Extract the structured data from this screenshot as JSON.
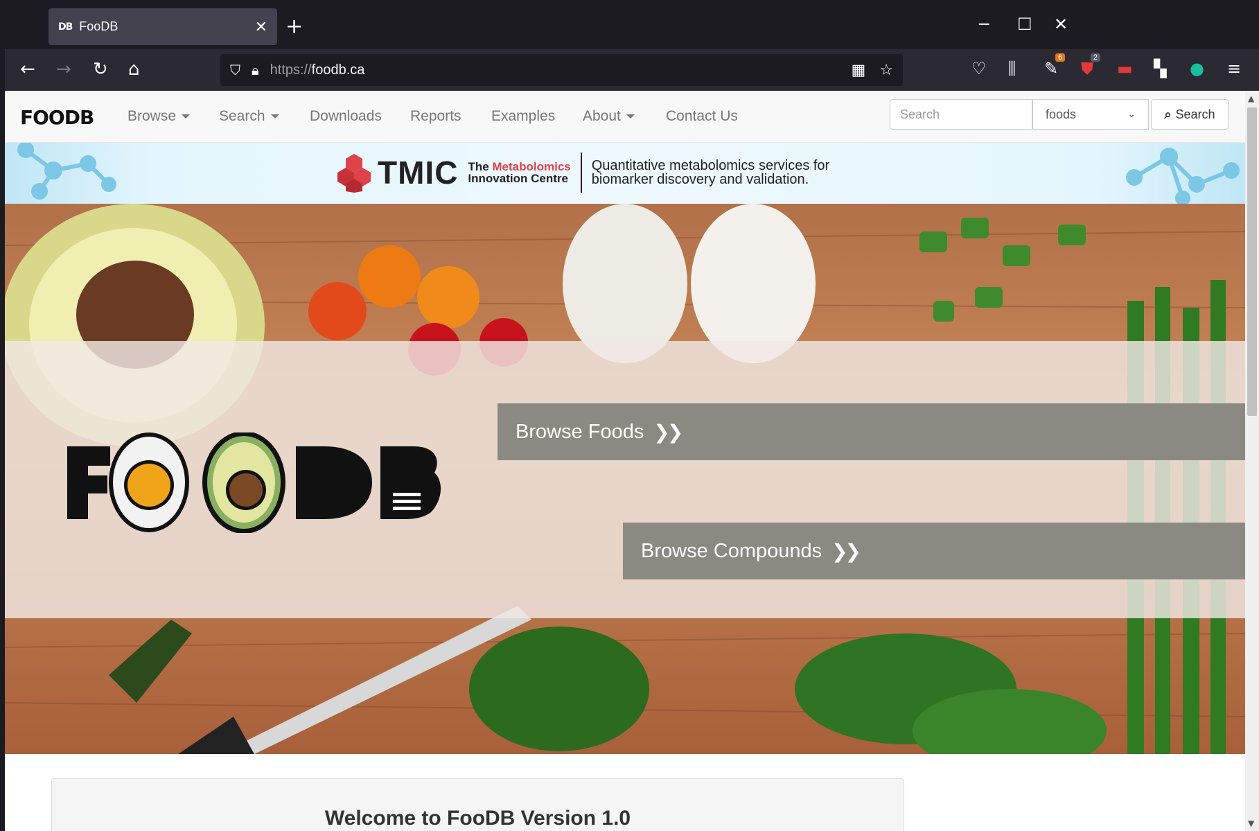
{
  "browser": {
    "tab_favicon": "DB",
    "tab_title": "FooDB",
    "tab_close": "✕",
    "new_tab": "+",
    "url_scheme": "https://",
    "url_host": "foodb.ca",
    "window": {
      "minimize": "─",
      "maximize": "☐",
      "close": "✕"
    },
    "badges": {
      "extension_1": "6",
      "extension_2": "2"
    }
  },
  "site": {
    "logo": "FOODB",
    "menu": [
      {
        "label": "Browse"
      },
      {
        "label": "Search"
      },
      {
        "label": "Downloads"
      },
      {
        "label": "Reports"
      },
      {
        "label": "Examples"
      },
      {
        "label": "About"
      },
      {
        "label": "Contact Us"
      }
    ],
    "search": {
      "placeholder": "Search",
      "selected": "foods",
      "button": "Search"
    }
  },
  "banner": {
    "brand": "TMIC",
    "sub_prefix": "The",
    "sub_red": "Metabolomics",
    "sub_line2": "Innovation Centre",
    "tagline_1": "Quantitative metabolomics services for",
    "tagline_2": "biomarker discovery and validation."
  },
  "hero": {
    "browse_foods": "Browse Foods",
    "browse_compounds": "Browse Compounds",
    "logo": "FOODB"
  },
  "welcome": {
    "title": "Welcome to FooDB Version 1.0"
  },
  "colors": {
    "button_grey": "#8a8a82",
    "tmic_red": "#e0424b",
    "nav_text": "#777777"
  }
}
